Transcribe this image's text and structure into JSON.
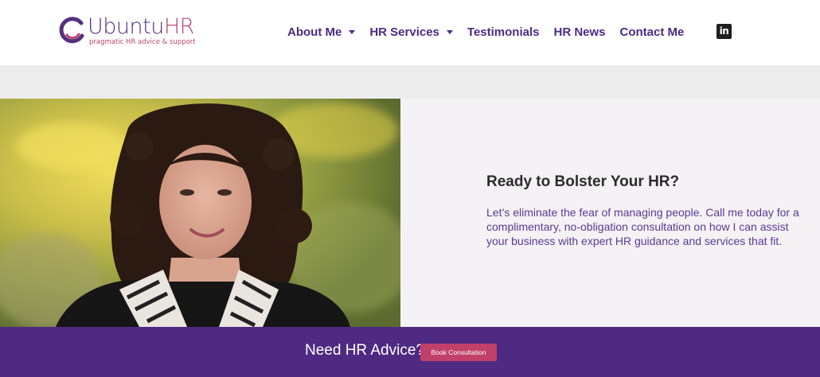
{
  "header": {
    "logo": {
      "word_part1": "Ubuntu",
      "word_part2": "HR",
      "tagline": "pragmatic HR advice & support"
    },
    "nav": [
      {
        "label": "About Me",
        "has_dropdown": true
      },
      {
        "label": "HR Services",
        "has_dropdown": true
      },
      {
        "label": "Testimonials",
        "has_dropdown": false
      },
      {
        "label": "HR News",
        "has_dropdown": false
      },
      {
        "label": "Contact Me",
        "has_dropdown": false
      }
    ],
    "social": {
      "icon": "linkedin-icon",
      "label": "in"
    }
  },
  "hero": {
    "title": "Ready to Bolster Your HR?",
    "body": "Let’s eliminate the fear of managing people. Call me today for a complimentary, no-obligation consultation on how I can assist your business with expert HR guidance and services that fit."
  },
  "cta": {
    "text": "Need HR Advice?",
    "button_label": "Book Consultation"
  },
  "colors": {
    "brand_purple": "#4f2a82",
    "brand_pink": "#c0406a",
    "panel_bg": "#f4f2f4",
    "band_grey": "#ededed"
  }
}
